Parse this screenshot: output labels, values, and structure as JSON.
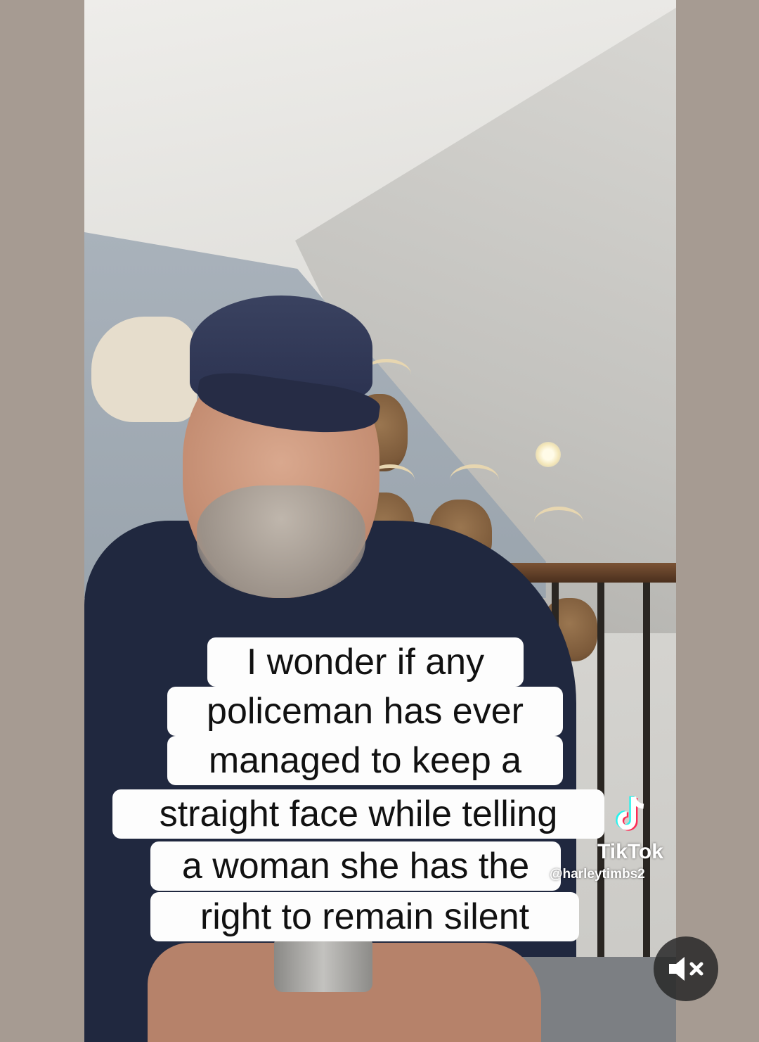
{
  "caption": {
    "lines": [
      "I wonder if any",
      "policeman has ever",
      "managed to keep a",
      "straight face while telling",
      "a woman she has the",
      "right to remain silent"
    ]
  },
  "watermark": {
    "brand": "TikTok",
    "username": "@harleytimbs2",
    "icon": "tiktok-logo-icon"
  },
  "controls": {
    "mute_icon": "speaker-muted-icon"
  },
  "colors": {
    "caption_bg": "#fdfdfd",
    "caption_text": "#111111",
    "side_bars": "#a69b92",
    "mute_bg": "#282828"
  }
}
